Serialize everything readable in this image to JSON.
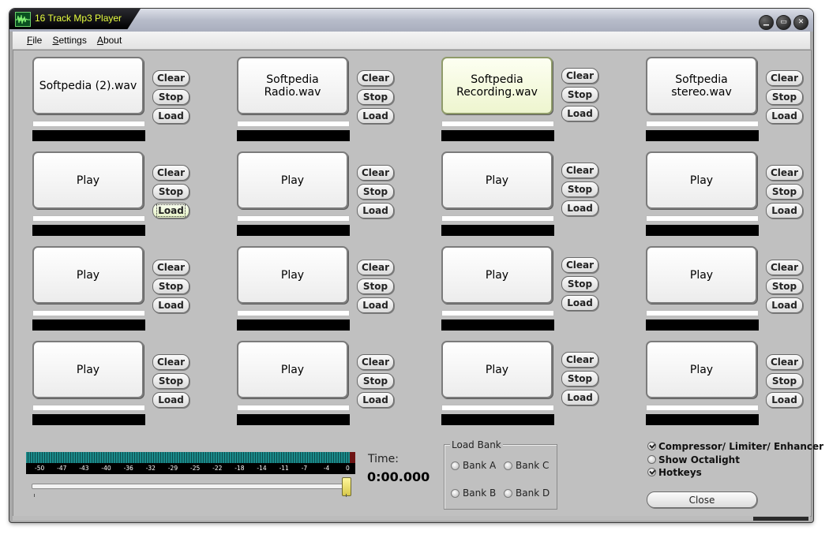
{
  "window": {
    "title": "16 Track Mp3 Player"
  },
  "menu": [
    {
      "label_u": "F",
      "label_rest": "ile"
    },
    {
      "label_u": "S",
      "label_rest": "ettings"
    },
    {
      "label_u": "A",
      "label_rest": "bout"
    }
  ],
  "slot_buttons": {
    "clear": "Clear",
    "stop": "Stop",
    "load": "Load"
  },
  "tracks": [
    {
      "label": "Softpedia (2).wav"
    },
    {
      "label": "Softpedia Radio.wav"
    },
    {
      "label": "Softpedia Recording.wav"
    },
    {
      "label": "Softpedia stereo.wav"
    },
    {
      "label": "Play"
    },
    {
      "label": "Play"
    },
    {
      "label": "Play"
    },
    {
      "label": "Play"
    },
    {
      "label": "Play"
    },
    {
      "label": "Play"
    },
    {
      "label": "Play"
    },
    {
      "label": "Play"
    },
    {
      "label": "Play"
    },
    {
      "label": "Play"
    },
    {
      "label": "Play"
    },
    {
      "label": "Play"
    }
  ],
  "meter": {
    "ticks": [
      "-50",
      "-47",
      "-43",
      "-40",
      "-36",
      "-32",
      "-29",
      "-25",
      "-22",
      "-18",
      "-14",
      "-11",
      "-7",
      "-4",
      "0"
    ]
  },
  "time": {
    "label": "Time:",
    "value": "0:00.000"
  },
  "load_bank": {
    "legend": "Load Bank",
    "options": [
      "Bank A",
      "Bank C",
      "Bank B",
      "Bank D"
    ]
  },
  "options": [
    {
      "label": "Compressor/ Limiter/ Enhancer",
      "checked": true
    },
    {
      "label": "Show Octalight",
      "checked": false
    },
    {
      "label": "Hotkeys",
      "checked": true
    }
  ],
  "close_label": "Close",
  "colors": {
    "title_text": "#e8ff40",
    "meter": "#1b8a8a",
    "active_pad": "#eef5cf"
  }
}
